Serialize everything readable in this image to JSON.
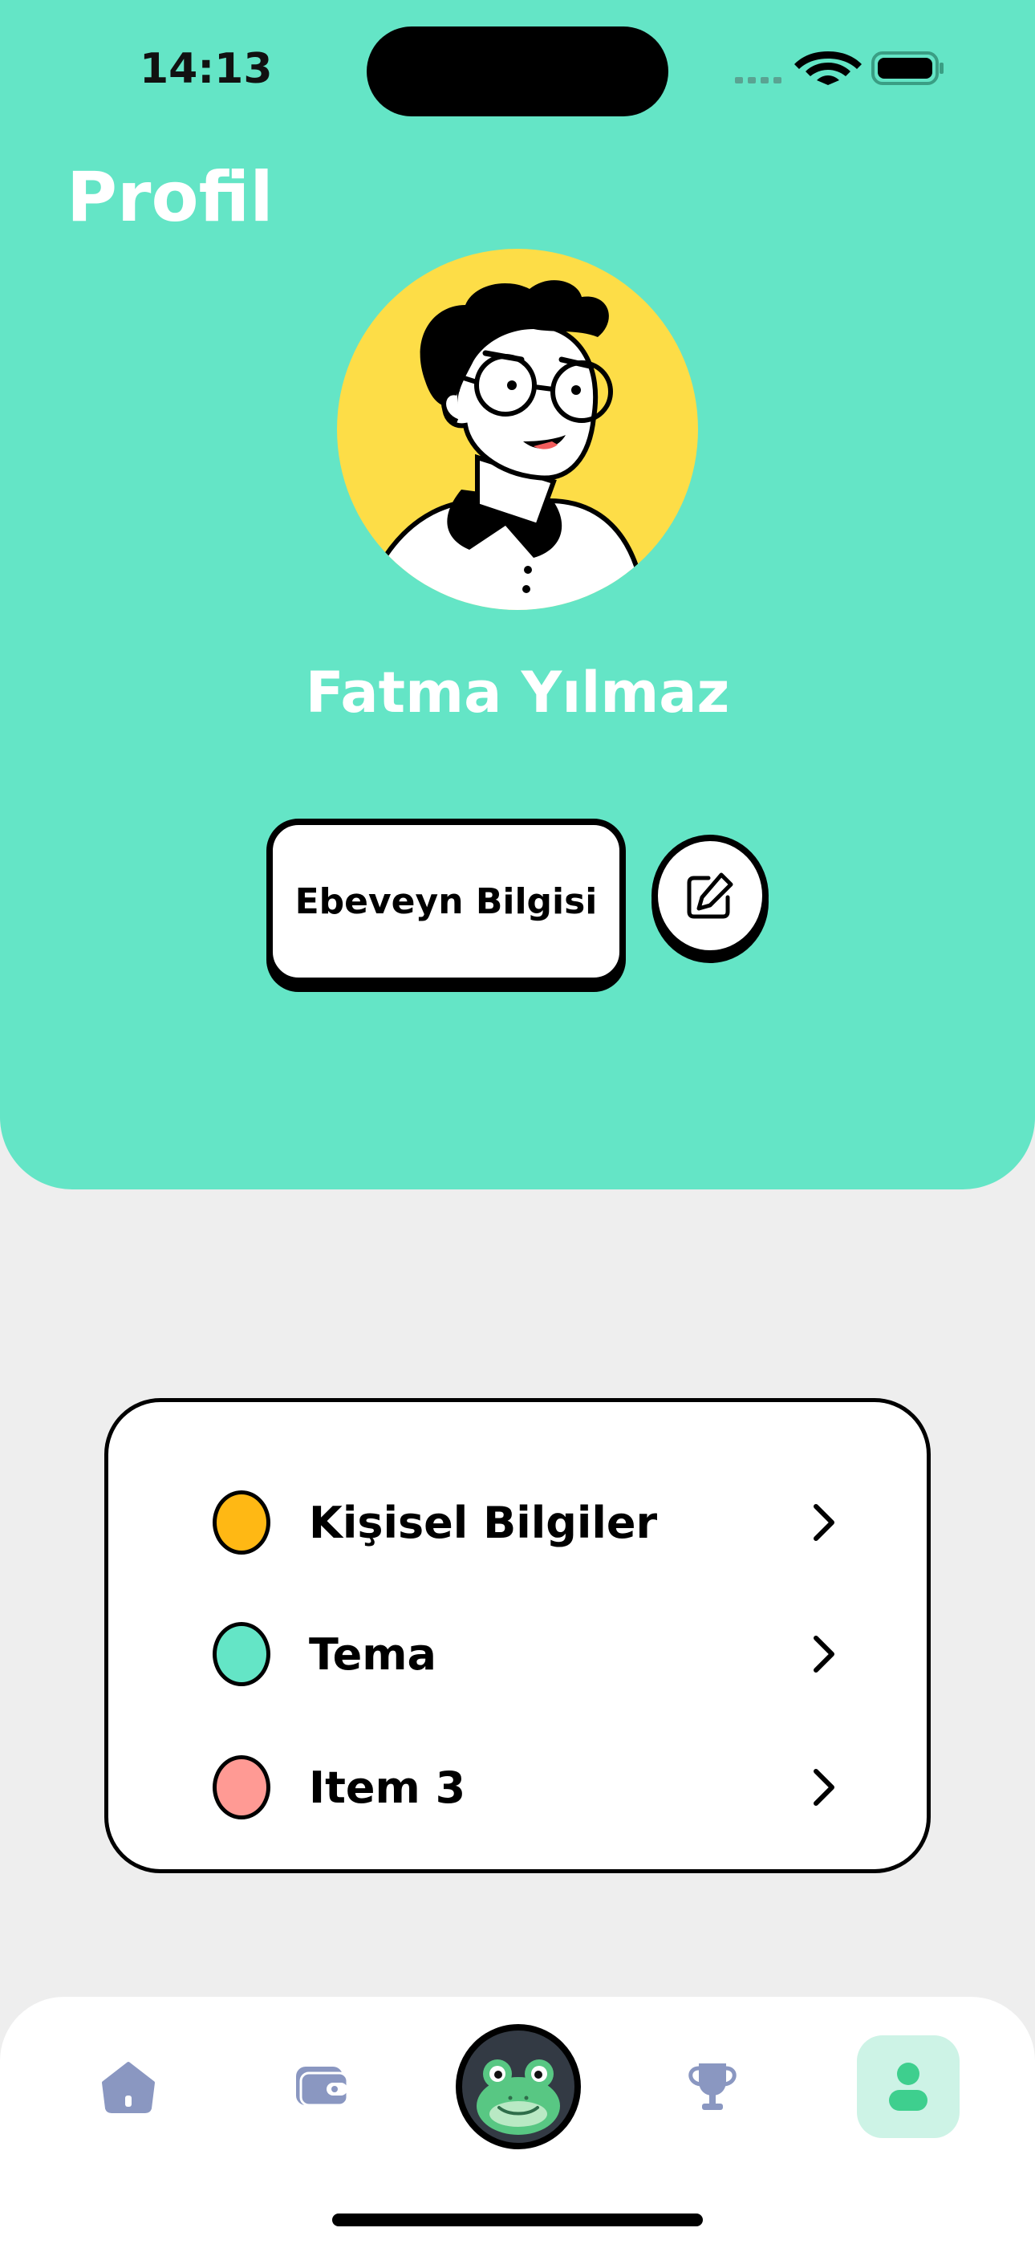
{
  "status_bar": {
    "time": "14:13"
  },
  "header": {
    "title": "Profil",
    "user_name": "Fatma Yılmaz",
    "parent_button_label": "Ebeveyn Bilgisi",
    "bg_color": "#64e5c6"
  },
  "menu": {
    "items": [
      {
        "label": "Kişisel Bilgiler",
        "color": "#ffb814"
      },
      {
        "label": "Tema",
        "color": "#64e5c6"
      },
      {
        "label": "Item 3",
        "color": "#ff9a94"
      }
    ]
  },
  "bottom_nav": {
    "items": [
      {
        "icon": "home-icon"
      },
      {
        "icon": "wallet-icon"
      },
      {
        "icon": "frog-mascot-icon"
      },
      {
        "icon": "trophy-icon"
      },
      {
        "icon": "profile-icon",
        "active": true
      }
    ]
  }
}
